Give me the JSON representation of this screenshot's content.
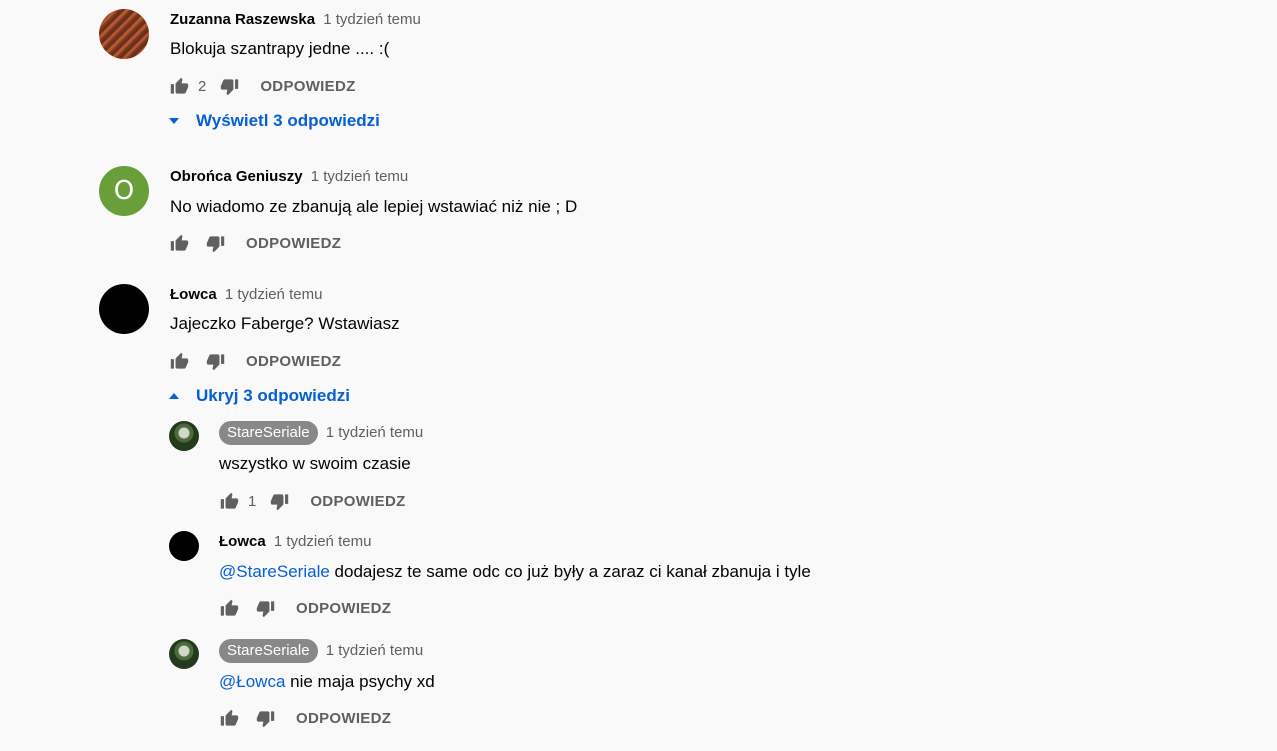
{
  "comments": [
    {
      "author": "Zuzanna Raszewska",
      "time": "1 tydzień temu",
      "text": "Blokuja szantrapy jedne .... :(",
      "likes": "2",
      "reply_label": "ODPOWIEDZ",
      "replies_toggle": "Wyświetl 3 odpowiedzi"
    },
    {
      "author": "Obrońca Geniuszy",
      "avatar_letter": "O",
      "time": "1 tydzień temu",
      "text": "No wiadomo ze zbanują ale lepiej wstawiać niż nie ; D",
      "reply_label": "ODPOWIEDZ"
    },
    {
      "author": "Łowca",
      "time": "1 tydzień temu",
      "text": "Jajeczko Faberge? Wstawiasz",
      "reply_label": "ODPOWIEDZ",
      "replies_toggle": "Ukryj 3 odpowiedzi"
    }
  ],
  "replies": [
    {
      "author": "StareSeriale",
      "time": "1 tydzień temu",
      "text": "wszystko w swoim czasie",
      "likes": "1",
      "reply_label": "ODPOWIEDZ"
    },
    {
      "author": "Łowca",
      "time": "1 tydzień temu",
      "mention": "@StareSeriale",
      "text": " dodajesz te same odc co już były a zaraz ci kanał zbanuja i tyle",
      "reply_label": "ODPOWIEDZ"
    },
    {
      "author": "StareSeriale",
      "time": "1 tydzień temu",
      "mention": "@Łowca",
      "text": " nie maja psychy xd",
      "reply_label": "ODPOWIEDZ"
    }
  ],
  "colors": {
    "background": "#f9f9f9",
    "link": "#065fd4",
    "secondary_text": "#606060",
    "owner_badge": "#888888",
    "avatar_letter_bg": "#689f38"
  },
  "icons": [
    "thumb-up-icon",
    "thumb-down-icon",
    "caret-down-icon",
    "caret-up-icon"
  ]
}
